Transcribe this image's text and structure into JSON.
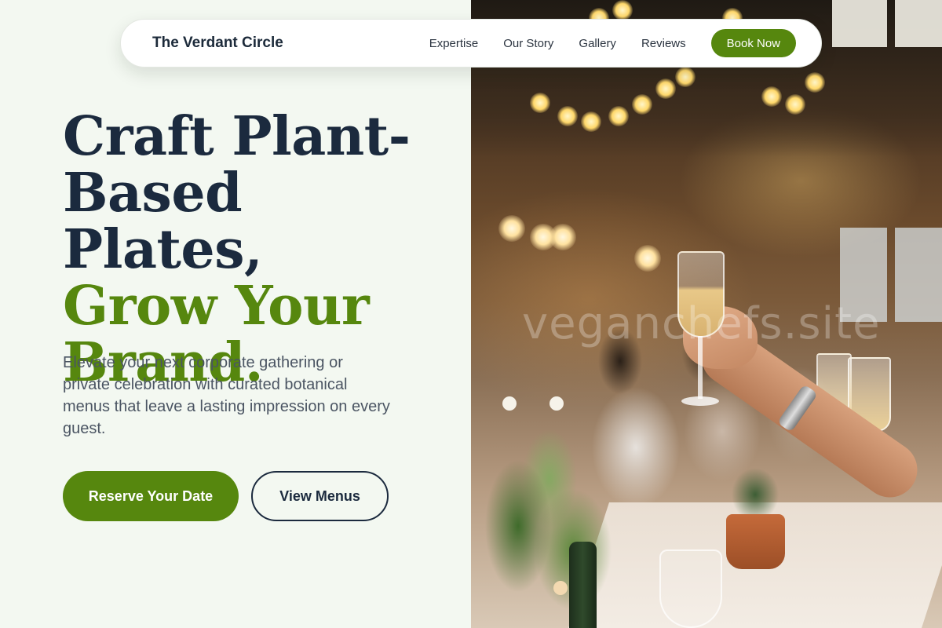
{
  "header": {
    "brand": "The Verdant Circle",
    "nav": [
      "Expertise",
      "Our Story",
      "Gallery",
      "Reviews"
    ],
    "cta": "Book Now"
  },
  "hero": {
    "headline_lines": [
      "Craft Plant-",
      "Based Plates,"
    ],
    "headline_accent_lines": [
      "Grow Your",
      "Brand."
    ],
    "subtext": "Elevate your next corporate gathering or private celebration with curated botanical menus that leave a lasting impression on every guest.",
    "primary_button": "Reserve Your Date",
    "secondary_button": "View Menus"
  },
  "image": {
    "watermark": "veganchefs.site"
  },
  "colors": {
    "accent": "#56870e",
    "heading": "#1b2a3e",
    "background": "#f3f8f1"
  }
}
